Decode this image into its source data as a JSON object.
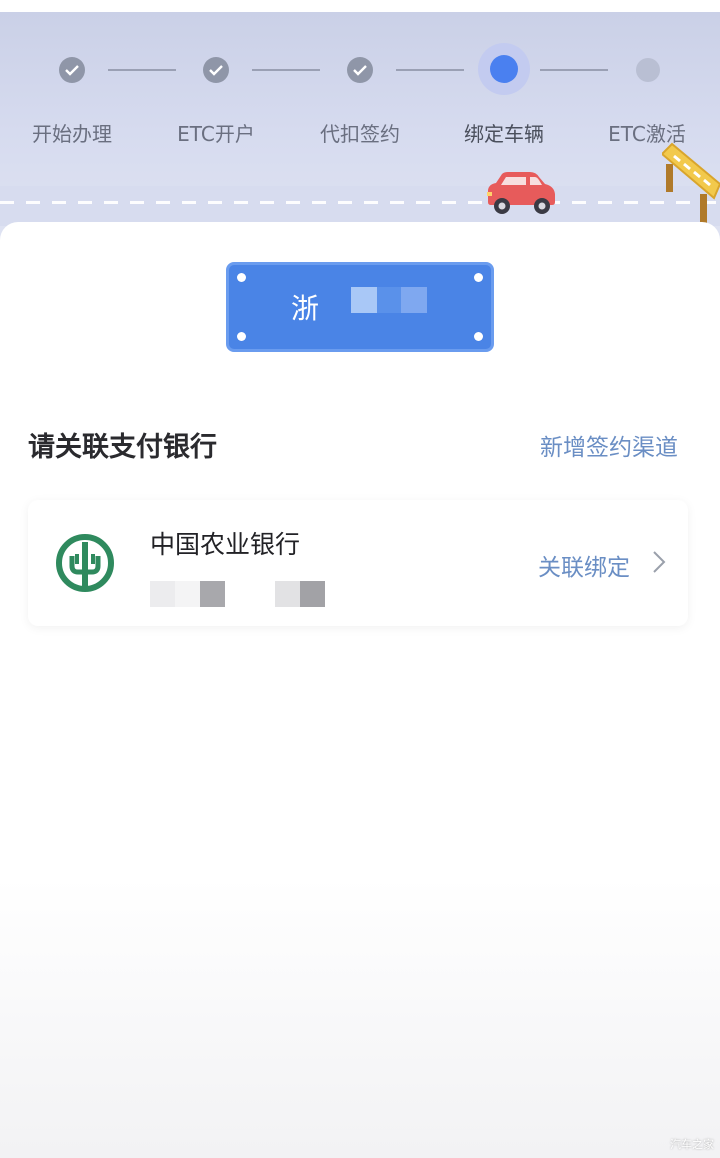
{
  "steps": [
    {
      "label": "开始办理",
      "state": "done"
    },
    {
      "label": "ETC开户",
      "state": "done"
    },
    {
      "label": "代扣签约",
      "state": "done"
    },
    {
      "label": "绑定车辆",
      "state": "active"
    },
    {
      "label": "ETC激活",
      "state": "todo"
    }
  ],
  "plate": {
    "prefix": "浙"
  },
  "section": {
    "title": "请关联支付银行",
    "action": "新增签约渠道"
  },
  "bank": {
    "name": "中国农业银行",
    "action": "关联绑定"
  },
  "watermark": "汽车之家",
  "colors": {
    "accent": "#4a80f0",
    "link": "#6a8ec4",
    "plate": "#4a84e6",
    "bank_green": "#2f8a5e",
    "car": "#e75b5b"
  },
  "icons": [
    "check-icon",
    "car-icon",
    "toll-gate-icon",
    "abc-bank-logo",
    "chevron-right-icon"
  ]
}
